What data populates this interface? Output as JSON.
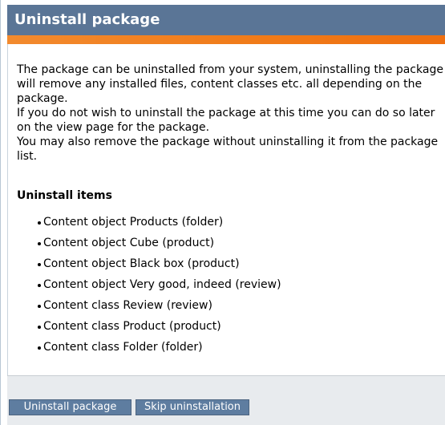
{
  "window": {
    "title": "Uninstall package"
  },
  "description": {
    "lines": [
      "The package can be uninstalled from your system, uninstalling the package will remove any installed files, content classes etc. all depending on the package.",
      "If you do not wish to uninstall the package at this time you can do so later on the view page for the package.",
      "You may also remove the package without uninstalling it from the package list."
    ]
  },
  "uninstall_items": {
    "heading": "Uninstall items",
    "items": [
      "Content object Products (folder)",
      "Content object Cube (product)",
      "Content object Black box (product)",
      "Content object Very good, indeed (review)",
      "Content class Review (review)",
      "Content class Product (product)",
      "Content class Folder (folder)"
    ]
  },
  "footer": {
    "uninstall_label": "Uninstall package",
    "skip_label": "Skip uninstallation"
  },
  "colors": {
    "titlebar": "#5a7596",
    "accent": "#f07a18",
    "button": "#5e7da0",
    "footer": "#e8ebee"
  }
}
